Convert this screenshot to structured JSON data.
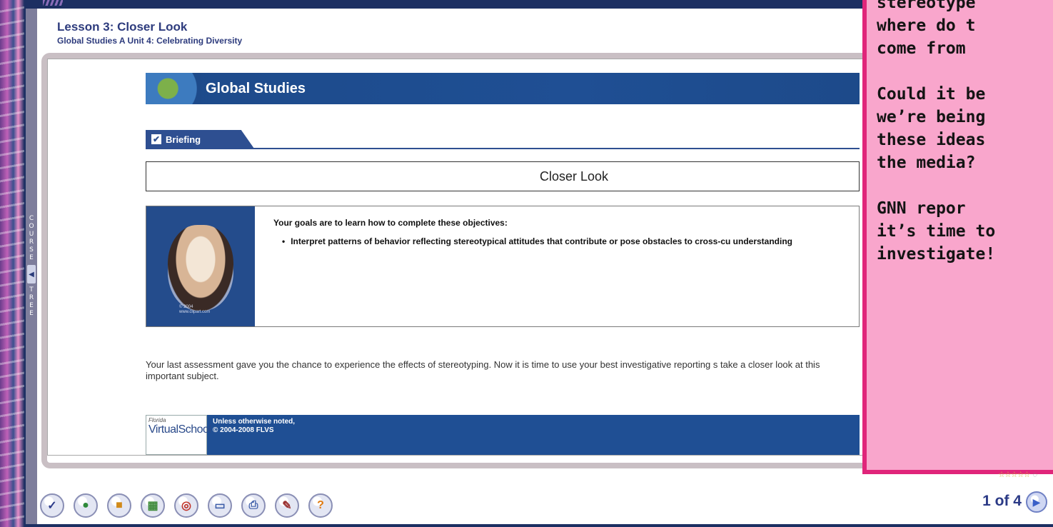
{
  "lesson": {
    "title": "Lesson 3: Closer Look",
    "subtitle": "Global Studies A  Unit 4: Celebrating Diversity"
  },
  "course_tree": {
    "label_top": "COURSE",
    "label_bottom": "TREE",
    "toggle_glyph": "◀"
  },
  "banner": {
    "title": "Global Studies",
    "icon": "globe-map-icon"
  },
  "briefing": {
    "tab_label": "Briefing",
    "checked": true
  },
  "section": {
    "title": "Closer Look"
  },
  "goals": {
    "heading": "Your goals are to learn how to complete these objectives:",
    "items": [
      "Interpret patterns of behavior reflecting stereotypical attitudes that contribute or pose obstacles to cross-cu understanding"
    ],
    "photo_credit_1": "© 2004",
    "photo_credit_2": "www.clipart.com"
  },
  "intro": {
    "text": "Your last assessment gave you the chance to experience the effects of stereotyping. Now it is time to use your best investigative reporting s take a closer look at this important subject."
  },
  "footer": {
    "logo_small": "Florida",
    "logo_big_1": "Virtual",
    "logo_big_2": "School",
    "note_1": "Unless otherwise noted,",
    "note_2": "© 2004-2008 FLVS"
  },
  "callout": {
    "lines_1": [
      "stereotype",
      "where do t",
      "come from"
    ],
    "lines_2": [
      "Could it be",
      "we’re being",
      "these ideas",
      "the media?"
    ],
    "lines_3": [
      "GNN repor",
      "it’s time to",
      "investigate!"
    ],
    "colors": {
      "background": "#f9a6cc",
      "border": "#e0257a"
    }
  },
  "toolbar": {
    "buttons": [
      {
        "name": "grade-check-icon",
        "glyph": "✓",
        "color": "#2c3b8a"
      },
      {
        "name": "course-arrow-icon",
        "glyph": "●",
        "color": "#2f8a3a"
      },
      {
        "name": "assessment-box-icon",
        "glyph": "■",
        "color": "#d18a1a"
      },
      {
        "name": "gradebook-icon",
        "glyph": "▦",
        "color": "#3d8a3a"
      },
      {
        "name": "target-icon",
        "glyph": "◎",
        "color": "#c2352a"
      },
      {
        "name": "message-window-icon",
        "glyph": "▭",
        "color": "#3b5ca8"
      },
      {
        "name": "print-icon",
        "glyph": "⎙",
        "color": "#3b5ca8"
      },
      {
        "name": "tools-icon",
        "glyph": "✎",
        "color": "#9a3030"
      },
      {
        "name": "help-icon",
        "glyph": "?",
        "color": "#e07a10"
      }
    ]
  },
  "pagination": {
    "rating_stars": "☆☆☆☆☆",
    "comment_glyph": "◌",
    "page_text": "1 of 4",
    "next_glyph": "▶"
  }
}
